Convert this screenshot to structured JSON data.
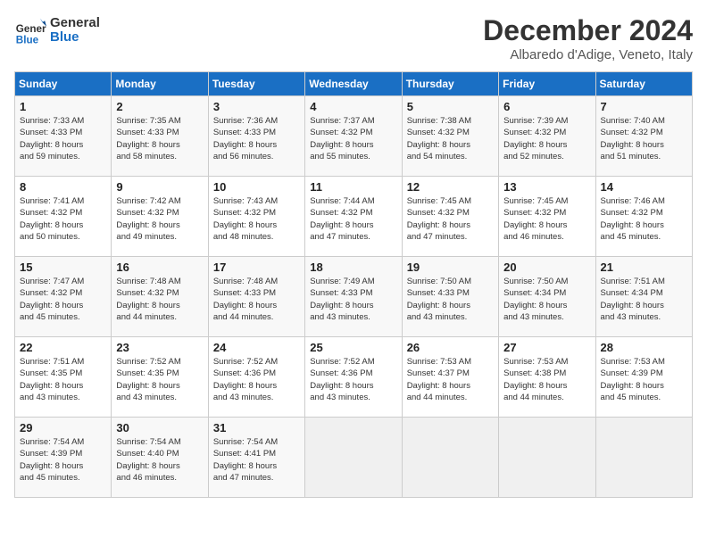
{
  "logo": {
    "line1": "General",
    "line2": "Blue"
  },
  "title": "December 2024",
  "subtitle": "Albaredo d'Adige, Veneto, Italy",
  "weekdays": [
    "Sunday",
    "Monday",
    "Tuesday",
    "Wednesday",
    "Thursday",
    "Friday",
    "Saturday"
  ],
  "weeks": [
    [
      {
        "day": "1",
        "info": "Sunrise: 7:33 AM\nSunset: 4:33 PM\nDaylight: 8 hours\nand 59 minutes."
      },
      {
        "day": "2",
        "info": "Sunrise: 7:35 AM\nSunset: 4:33 PM\nDaylight: 8 hours\nand 58 minutes."
      },
      {
        "day": "3",
        "info": "Sunrise: 7:36 AM\nSunset: 4:33 PM\nDaylight: 8 hours\nand 56 minutes."
      },
      {
        "day": "4",
        "info": "Sunrise: 7:37 AM\nSunset: 4:32 PM\nDaylight: 8 hours\nand 55 minutes."
      },
      {
        "day": "5",
        "info": "Sunrise: 7:38 AM\nSunset: 4:32 PM\nDaylight: 8 hours\nand 54 minutes."
      },
      {
        "day": "6",
        "info": "Sunrise: 7:39 AM\nSunset: 4:32 PM\nDaylight: 8 hours\nand 52 minutes."
      },
      {
        "day": "7",
        "info": "Sunrise: 7:40 AM\nSunset: 4:32 PM\nDaylight: 8 hours\nand 51 minutes."
      }
    ],
    [
      {
        "day": "8",
        "info": "Sunrise: 7:41 AM\nSunset: 4:32 PM\nDaylight: 8 hours\nand 50 minutes."
      },
      {
        "day": "9",
        "info": "Sunrise: 7:42 AM\nSunset: 4:32 PM\nDaylight: 8 hours\nand 49 minutes."
      },
      {
        "day": "10",
        "info": "Sunrise: 7:43 AM\nSunset: 4:32 PM\nDaylight: 8 hours\nand 48 minutes."
      },
      {
        "day": "11",
        "info": "Sunrise: 7:44 AM\nSunset: 4:32 PM\nDaylight: 8 hours\nand 47 minutes."
      },
      {
        "day": "12",
        "info": "Sunrise: 7:45 AM\nSunset: 4:32 PM\nDaylight: 8 hours\nand 47 minutes."
      },
      {
        "day": "13",
        "info": "Sunrise: 7:45 AM\nSunset: 4:32 PM\nDaylight: 8 hours\nand 46 minutes."
      },
      {
        "day": "14",
        "info": "Sunrise: 7:46 AM\nSunset: 4:32 PM\nDaylight: 8 hours\nand 45 minutes."
      }
    ],
    [
      {
        "day": "15",
        "info": "Sunrise: 7:47 AM\nSunset: 4:32 PM\nDaylight: 8 hours\nand 45 minutes."
      },
      {
        "day": "16",
        "info": "Sunrise: 7:48 AM\nSunset: 4:32 PM\nDaylight: 8 hours\nand 44 minutes."
      },
      {
        "day": "17",
        "info": "Sunrise: 7:48 AM\nSunset: 4:33 PM\nDaylight: 8 hours\nand 44 minutes."
      },
      {
        "day": "18",
        "info": "Sunrise: 7:49 AM\nSunset: 4:33 PM\nDaylight: 8 hours\nand 43 minutes."
      },
      {
        "day": "19",
        "info": "Sunrise: 7:50 AM\nSunset: 4:33 PM\nDaylight: 8 hours\nand 43 minutes."
      },
      {
        "day": "20",
        "info": "Sunrise: 7:50 AM\nSunset: 4:34 PM\nDaylight: 8 hours\nand 43 minutes."
      },
      {
        "day": "21",
        "info": "Sunrise: 7:51 AM\nSunset: 4:34 PM\nDaylight: 8 hours\nand 43 minutes."
      }
    ],
    [
      {
        "day": "22",
        "info": "Sunrise: 7:51 AM\nSunset: 4:35 PM\nDaylight: 8 hours\nand 43 minutes."
      },
      {
        "day": "23",
        "info": "Sunrise: 7:52 AM\nSunset: 4:35 PM\nDaylight: 8 hours\nand 43 minutes."
      },
      {
        "day": "24",
        "info": "Sunrise: 7:52 AM\nSunset: 4:36 PM\nDaylight: 8 hours\nand 43 minutes."
      },
      {
        "day": "25",
        "info": "Sunrise: 7:52 AM\nSunset: 4:36 PM\nDaylight: 8 hours\nand 43 minutes."
      },
      {
        "day": "26",
        "info": "Sunrise: 7:53 AM\nSunset: 4:37 PM\nDaylight: 8 hours\nand 44 minutes."
      },
      {
        "day": "27",
        "info": "Sunrise: 7:53 AM\nSunset: 4:38 PM\nDaylight: 8 hours\nand 44 minutes."
      },
      {
        "day": "28",
        "info": "Sunrise: 7:53 AM\nSunset: 4:39 PM\nDaylight: 8 hours\nand 45 minutes."
      }
    ],
    [
      {
        "day": "29",
        "info": "Sunrise: 7:54 AM\nSunset: 4:39 PM\nDaylight: 8 hours\nand 45 minutes."
      },
      {
        "day": "30",
        "info": "Sunrise: 7:54 AM\nSunset: 4:40 PM\nDaylight: 8 hours\nand 46 minutes."
      },
      {
        "day": "31",
        "info": "Sunrise: 7:54 AM\nSunset: 4:41 PM\nDaylight: 8 hours\nand 47 minutes."
      },
      null,
      null,
      null,
      null
    ]
  ]
}
